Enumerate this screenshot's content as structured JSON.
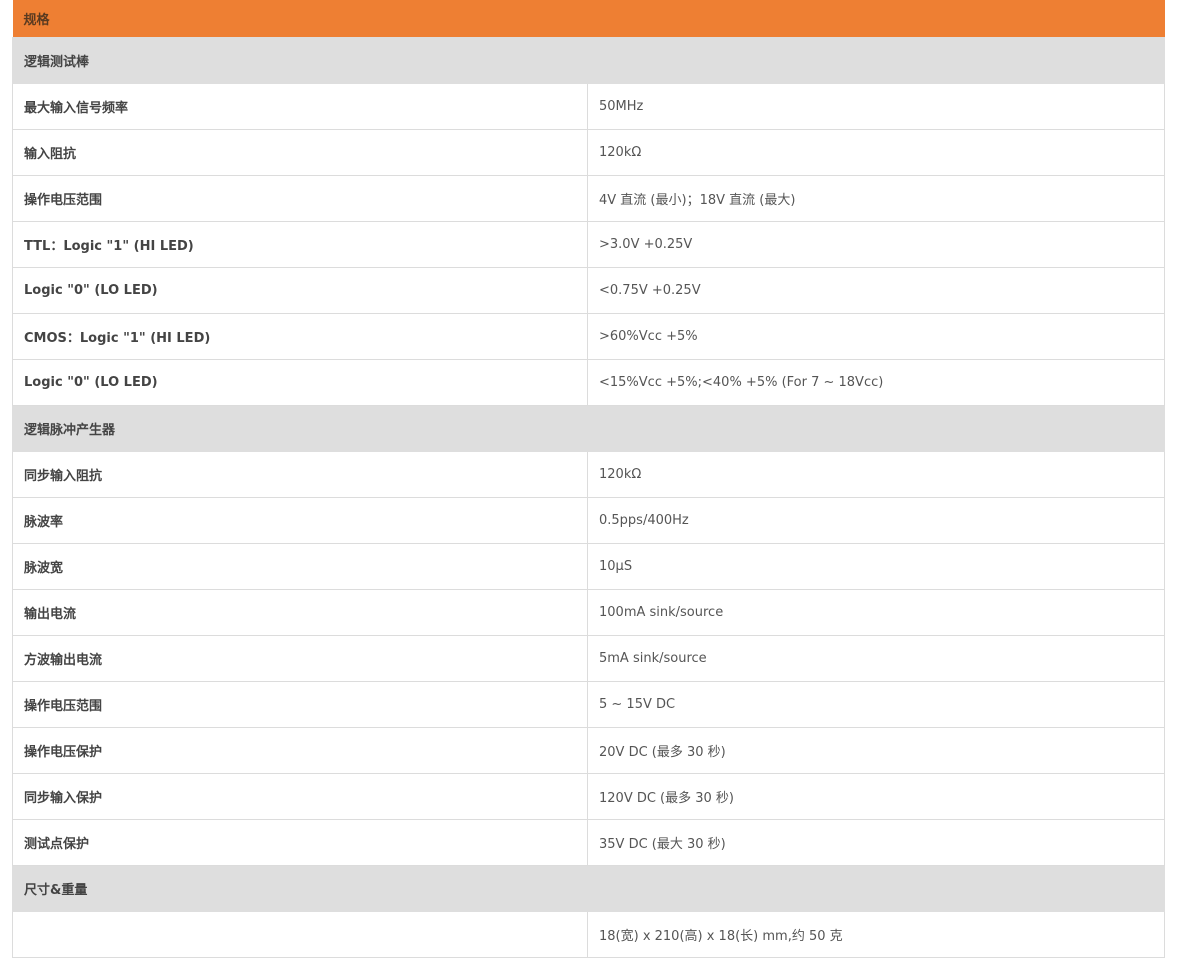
{
  "title": "规格",
  "sections": [
    {
      "heading": "逻辑测试棒",
      "rows": [
        {
          "label": "最大输入信号频率",
          "value": "50MHz"
        },
        {
          "label": "输入阻抗",
          "value": "120kΩ"
        },
        {
          "label": "操作电压范围",
          "value": "4V 直流 (最小)；18V 直流 (最大)"
        },
        {
          "label": "TTL：Logic \"1\" (HI LED)",
          "value": ">3.0V +0.25V"
        },
        {
          "label": "Logic \"0\" (LO LED)",
          "value": "<0.75V +0.25V"
        },
        {
          "label": "CMOS：Logic \"1\" (HI LED)",
          "value": ">60%Vcc +5%"
        },
        {
          "label": "Logic \"0\" (LO LED)",
          "value": "<15%Vcc +5%;<40% +5% (For 7 ~ 18Vcc)"
        }
      ]
    },
    {
      "heading": "逻辑脉冲产生器",
      "rows": [
        {
          "label": "同步输入阻抗",
          "value": "120kΩ"
        },
        {
          "label": "脉波率",
          "value": "0.5pps/400Hz"
        },
        {
          "label": "脉波宽",
          "value": "10μS"
        },
        {
          "label": "输出电流",
          "value": "100mA sink/source"
        },
        {
          "label": "方波输出电流",
          "value": "5mA sink/source"
        },
        {
          "label": "操作电压范围",
          "value": "5 ~ 15V DC"
        },
        {
          "label": "操作电压保护",
          "value": "20V DC (最多 30 秒)"
        },
        {
          "label": "同步输入保护",
          "value": "120V DC (最多 30 秒)"
        },
        {
          "label": "测试点保护",
          "value": "35V DC (最大 30 秒)"
        }
      ]
    },
    {
      "heading": "尺寸&重量",
      "rows": [
        {
          "label": "",
          "value": "18(宽) x 210(高) x 18(长) mm,约 50 克"
        }
      ]
    }
  ]
}
